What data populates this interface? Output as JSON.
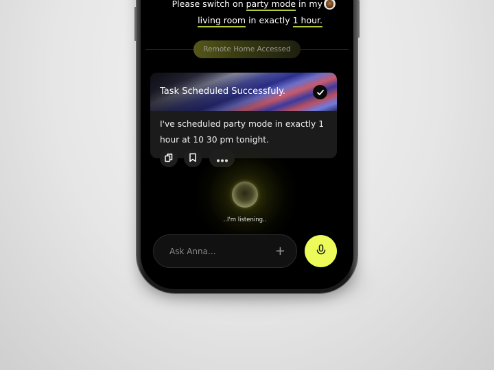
{
  "chat": {
    "user_message": {
      "line1_pre": "Please switch on ",
      "line1_highlight": "party mode",
      "line1_post": " in my",
      "line2_highlight1": "living room",
      "line2_mid": " in exactly ",
      "line2_highlight2": "1 hour.",
      "avatar_icon": "user-avatar"
    },
    "status_pill": "Remote Home Accessed",
    "task_card": {
      "title": "Task Scheduled Successfuly.",
      "status_icon": "check-icon",
      "body": "I've scheduled party mode in exactly 1 hour at 10 30 pm tonight."
    },
    "actions": [
      {
        "name": "copy",
        "icon": "copy-icon"
      },
      {
        "name": "bookmark",
        "icon": "bookmark-icon"
      },
      {
        "name": "more",
        "icon": "more-icon"
      }
    ],
    "listening_text": "..I'm listening.."
  },
  "composer": {
    "placeholder": "Ask Anna...",
    "add_symbol": "+",
    "mic_icon": "microphone-icon"
  },
  "colors": {
    "accent": "#ECFB5A",
    "highlight_underline": "#B7C93A",
    "background": "#000000"
  }
}
